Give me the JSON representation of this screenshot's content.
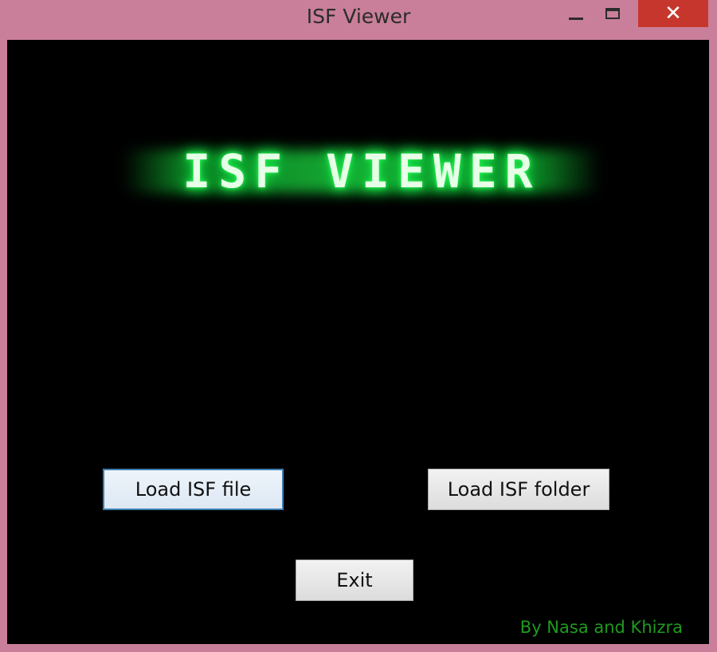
{
  "window": {
    "title": "ISF Viewer",
    "controls": {
      "minimize": "minimize",
      "maximize": "maximize",
      "close": "✕"
    }
  },
  "main": {
    "logo_text": "ISF VIEWER",
    "buttons": {
      "load_file": "Load ISF file",
      "load_folder": "Load ISF folder",
      "exit": "Exit"
    },
    "credit": "By Nasa and Khizra"
  },
  "colors": {
    "frame": "#c97f99",
    "client_bg": "#000000",
    "close_button": "#c7362c",
    "logo_glow": "#17e34a",
    "credit_text": "#1f9a1f"
  }
}
